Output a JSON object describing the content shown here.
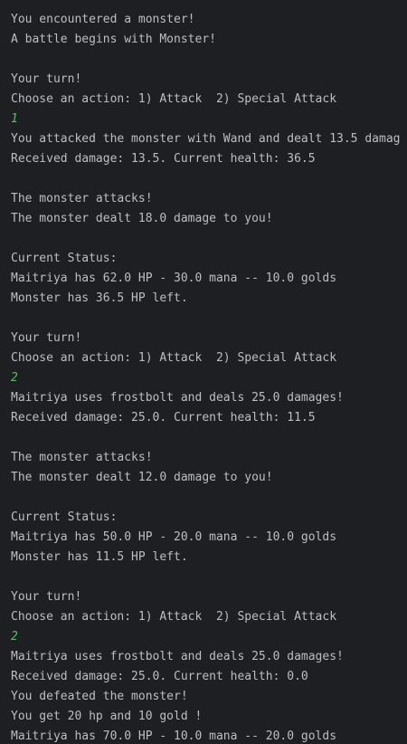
{
  "console": {
    "lines": [
      {
        "text": "-------------------------------",
        "kind": "output"
      },
      {
        "text": "You encountered a monster!",
        "kind": "output"
      },
      {
        "text": "A battle begins with Monster!",
        "kind": "output"
      },
      {
        "text": "",
        "kind": "output"
      },
      {
        "text": "Your turn!",
        "kind": "output"
      },
      {
        "text": "Choose an action: 1) Attack  2) Special Attack",
        "kind": "output"
      },
      {
        "text": "1",
        "kind": "input"
      },
      {
        "text": "You attacked the monster with Wand and dealt 13.5 damag",
        "kind": "output"
      },
      {
        "text": "Received damage: 13.5. Current health: 36.5",
        "kind": "output"
      },
      {
        "text": "",
        "kind": "output"
      },
      {
        "text": "The monster attacks!",
        "kind": "output"
      },
      {
        "text": "The monster dealt 18.0 damage to you!",
        "kind": "output"
      },
      {
        "text": "",
        "kind": "output"
      },
      {
        "text": "Current Status:",
        "kind": "output"
      },
      {
        "text": "Maitriya has 62.0 HP - 30.0 mana -- 10.0 golds",
        "kind": "output"
      },
      {
        "text": "Monster has 36.5 HP left.",
        "kind": "output"
      },
      {
        "text": "",
        "kind": "output"
      },
      {
        "text": "Your turn!",
        "kind": "output"
      },
      {
        "text": "Choose an action: 1) Attack  2) Special Attack",
        "kind": "output"
      },
      {
        "text": "2",
        "kind": "input"
      },
      {
        "text": "Maitriya uses frostbolt and deals 25.0 damages!",
        "kind": "output"
      },
      {
        "text": "Received damage: 25.0. Current health: 11.5",
        "kind": "output"
      },
      {
        "text": "",
        "kind": "output"
      },
      {
        "text": "The monster attacks!",
        "kind": "output"
      },
      {
        "text": "The monster dealt 12.0 damage to you!",
        "kind": "output"
      },
      {
        "text": "",
        "kind": "output"
      },
      {
        "text": "Current Status:",
        "kind": "output"
      },
      {
        "text": "Maitriya has 50.0 HP - 20.0 mana -- 10.0 golds",
        "kind": "output"
      },
      {
        "text": "Monster has 11.5 HP left.",
        "kind": "output"
      },
      {
        "text": "",
        "kind": "output"
      },
      {
        "text": "Your turn!",
        "kind": "output"
      },
      {
        "text": "Choose an action: 1) Attack  2) Special Attack",
        "kind": "output"
      },
      {
        "text": "2",
        "kind": "input"
      },
      {
        "text": "Maitriya uses frostbolt and deals 25.0 damages!",
        "kind": "output"
      },
      {
        "text": "Received damage: 25.0. Current health: 0.0",
        "kind": "output"
      },
      {
        "text": "You defeated the monster!",
        "kind": "output"
      },
      {
        "text": "You get 20 hp and 10 gold !",
        "kind": "output"
      },
      {
        "text": "Maitriya has 70.0 HP - 10.0 mana -- 20.0 golds",
        "kind": "output"
      }
    ]
  },
  "colors": {
    "background": "#1e1f22",
    "output_text": "#bcbec4",
    "input_text": "#5fb865"
  }
}
